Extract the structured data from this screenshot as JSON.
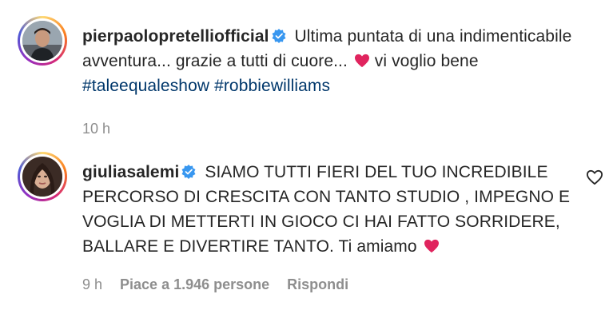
{
  "post": {
    "username": "pierpaolopretelliofficial",
    "caption_line1": "Ultima puntata di una indimenticabile",
    "caption_line2": "avventura... grazie a tutti di cuore...",
    "caption_line2_after": "vi voglio bene",
    "hashtags": [
      "#taleequaleshow",
      "#robbiewilliams"
    ],
    "time": "10 h"
  },
  "comment": {
    "username": "giuliasalemi",
    "line1": "SIAMO TUTTI FIERI DEL TUO INCREDIBILE",
    "line2": "PERCORSO DI CRESCITA CON TANTO STUDIO , IMPEGNO E",
    "line3": "VOGLIA DI METTERTI IN GIOCO CI HAI FATTO SORRIDERE,",
    "line4": "BALLARE E DIVERTIRE TANTO. Ti amiamo",
    "time": "9 h",
    "likes": "Piace a 1.946 persone",
    "reply": "Rispondi"
  },
  "colors": {
    "text": "#262626",
    "secondary": "#8e8e8e",
    "hashtag": "#00376b",
    "verified": "#3897f0",
    "heart": "#e0245e"
  },
  "icons": {
    "verified": "verified-badge-icon",
    "heart_emoji": "red-heart-emoji-icon",
    "like": "heart-outline-icon"
  }
}
